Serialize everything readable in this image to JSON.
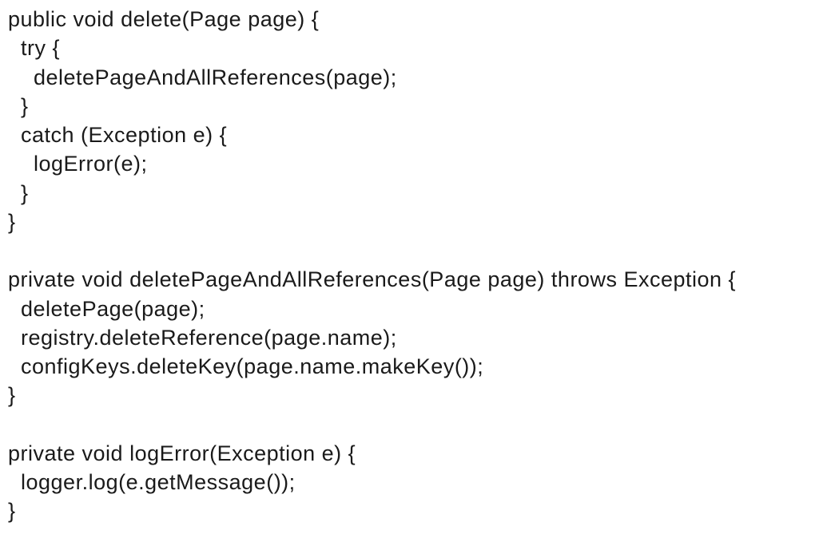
{
  "code_lines": [
    "public void delete(Page page) {",
    "  try {",
    "    deletePageAndAllReferences(page);",
    "  }",
    "  catch (Exception e) {",
    "    logError(e);",
    "  }",
    "}",
    "",
    "private void deletePageAndAllReferences(Page page) throws Exception {",
    "  deletePage(page);",
    "  registry.deleteReference(page.name);",
    "  configKeys.deleteKey(page.name.makeKey());",
    "}",
    "",
    "private void logError(Exception e) {",
    "  logger.log(e.getMessage());",
    "}"
  ]
}
